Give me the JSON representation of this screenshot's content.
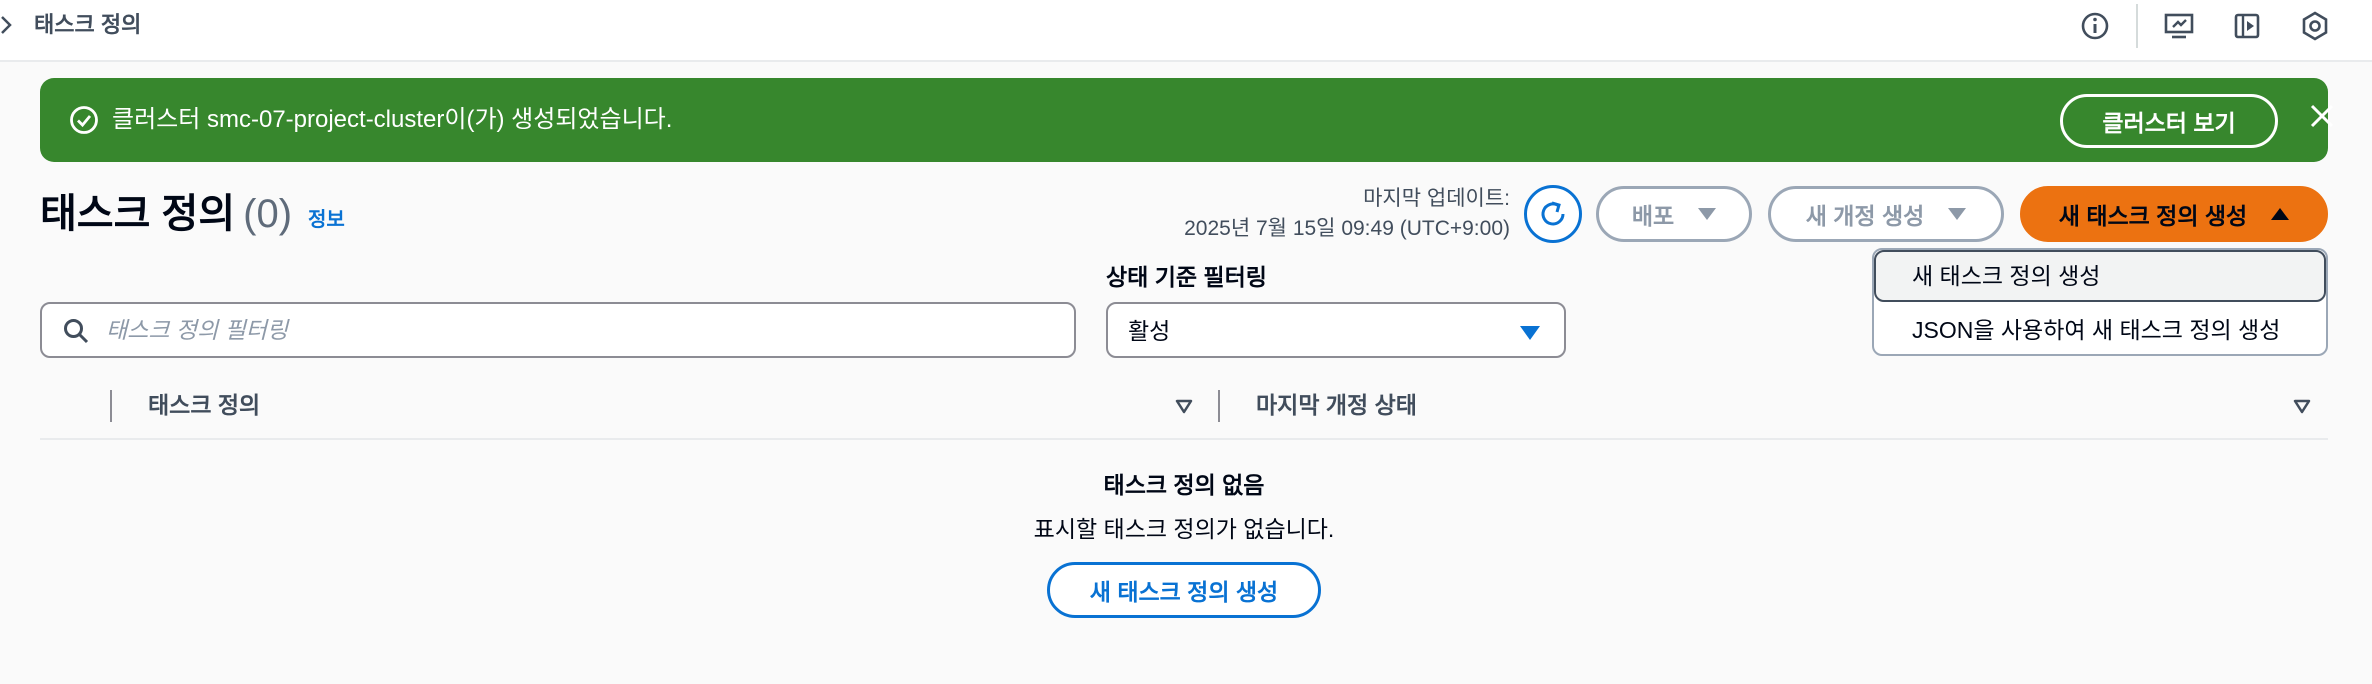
{
  "breadcrumb": {
    "title": "태스크 정의"
  },
  "topbar": {
    "icons": [
      "info-icon",
      "screen-share-icon",
      "execute-panel-icon",
      "settings-hexagon-icon"
    ]
  },
  "flash": {
    "message": "클러스터 smc-07-project-cluster이(가) 생성되었습니다.",
    "action_label": "클러스터 보기",
    "color": "#37872d"
  },
  "header": {
    "title": "태스크 정의",
    "count": "(0)",
    "info_label": "정보",
    "last_updated_label": "마지막 업데이트:",
    "last_updated_value": "2025년 7월 15일 09:49 (UTC+9:00)"
  },
  "actions": {
    "deploy_label": "배포",
    "new_revision_label": "새 개정 생성",
    "create_label": "새 태스크 정의 생성",
    "menu_items": [
      "새 태스크 정의 생성",
      "JSON을 사용하여 새 태스크 정의 생성"
    ],
    "primary_color": "#ec7211"
  },
  "filters": {
    "search_placeholder": "태스크 정의 필터링",
    "status_label": "상태 기준 필터링",
    "status_value": "활성"
  },
  "table": {
    "columns": [
      "태스크 정의",
      "마지막 개정 상태"
    ]
  },
  "empty_state": {
    "title": "태스크 정의 없음",
    "description": "표시할 태스크 정의가 없습니다.",
    "button_label": "새 태스크 정의 생성"
  }
}
